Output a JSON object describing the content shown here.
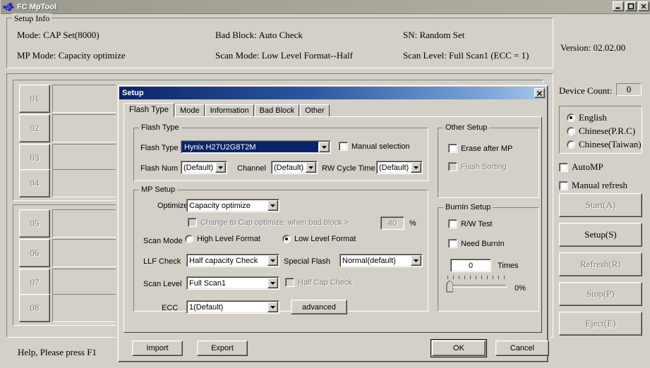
{
  "window": {
    "title": "FC MpTool",
    "icon": "usb-icon",
    "minimize_label": "_",
    "maximize_label": "□",
    "close_label": "×"
  },
  "setup_info": {
    "legend": "Setup Info",
    "col1": [
      "Mode: CAP Set(8000)",
      "MP Mode: Capacity optimize"
    ],
    "col2": [
      "Bad Block: Auto Check",
      "Scan Mode: Low Level Format--Half"
    ],
    "col3": [
      "SN: Random Set",
      "Scan Level: Full Scan1 (ECC = 1)"
    ],
    "version": "Version: 02.02.00"
  },
  "devices": {
    "slots": [
      "01",
      "02",
      "03",
      "04",
      "05",
      "06",
      "07",
      "08"
    ]
  },
  "status_bar": {
    "text": "Help, Please press F1"
  },
  "sidebar": {
    "device_count_label": "Device Count:",
    "device_count_value": "0",
    "languages": [
      {
        "label": "English",
        "selected": true
      },
      {
        "label": "Chinese(P.R.C)",
        "selected": false
      },
      {
        "label": "Chinese(Taiwan)",
        "selected": false
      }
    ],
    "checks": [
      {
        "label": "AutoMP",
        "checked": false
      },
      {
        "label": "Manual refresh",
        "checked": false
      }
    ],
    "buttons": [
      {
        "label": "Start(A)",
        "enabled": false
      },
      {
        "label": "Setup(S)",
        "enabled": true
      },
      {
        "label": "Refresh(R)",
        "enabled": false
      },
      {
        "label": "Stop(P)",
        "enabled": false
      },
      {
        "label": "Eject(E)",
        "enabled": false
      }
    ]
  },
  "dialog": {
    "title": "Setup",
    "close_label": "×",
    "tabs": [
      {
        "label": "Flash Type",
        "active": true
      },
      {
        "label": "Mode",
        "active": false
      },
      {
        "label": "Information",
        "active": false
      },
      {
        "label": "Bad Block",
        "active": false
      },
      {
        "label": "Other",
        "active": false
      }
    ],
    "flash_type_group": {
      "legend": "Flash Type",
      "flash_type_label": "Flash Type",
      "flash_type_value": "Hynix H27U2G8T2M",
      "manual_selection_label": "Manual selection",
      "manual_selection_checked": false,
      "flash_num_label": "Flash Num",
      "flash_num_value": "(Default)",
      "channel_label": "Channel",
      "channel_value": "(Default)",
      "rw_cycle_label": "RW Cycle Time",
      "rw_cycle_value": "(Default)"
    },
    "mp_setup_group": {
      "legend": "MP Setup",
      "optimize_label": "Optimize",
      "optimize_value": "Capacity optimize",
      "change_cap_label": "Change to Cap optimize, when bad block  >",
      "change_cap_checked": false,
      "change_cap_enabled": false,
      "bad_block_percent": "40",
      "percent_sign": "%",
      "scan_mode_label": "Scan Mode",
      "scan_mode_options": [
        {
          "label": "High Level Format",
          "selected": false
        },
        {
          "label": "Low Level Format",
          "selected": true
        }
      ],
      "llf_check_label": "LLF Check",
      "llf_check_value": "Half capacity Check",
      "special_flash_label": "Special Flash",
      "special_flash_value": "Normal(default)",
      "scan_level_label": "Scan Level",
      "scan_level_value": "Full Scan1",
      "half_cap_check_label": "Half Cap Check",
      "half_cap_check_checked": false,
      "half_cap_check_enabled": false,
      "ecc_label": "ECC",
      "ecc_value": "1(Default)",
      "advanced_label": "advanced"
    },
    "other_setup_group": {
      "legend": "Other Setup",
      "items": [
        {
          "label": "Erase after MP",
          "checked": false,
          "enabled": true
        },
        {
          "label": "Flash Sorting",
          "checked": false,
          "enabled": false
        }
      ]
    },
    "burnin_setup_group": {
      "legend": "BurnIn Setup",
      "items": [
        {
          "label": "R/W Test",
          "checked": false,
          "enabled": true
        },
        {
          "label": "Need BurnIn",
          "checked": false,
          "enabled": true
        }
      ],
      "times_value": "0",
      "times_label": "Times",
      "progress_label": "0%",
      "progress_percent": 0
    },
    "buttons": {
      "import": "Import",
      "export": "Export",
      "ok": "OK",
      "cancel": "Cancel"
    }
  },
  "colors": {
    "face": "#d4d0c8",
    "title_active_start": "#0a246a",
    "title_active_end": "#a6c8ea",
    "selection": "#0a246a",
    "disabled_text": "#808080"
  }
}
